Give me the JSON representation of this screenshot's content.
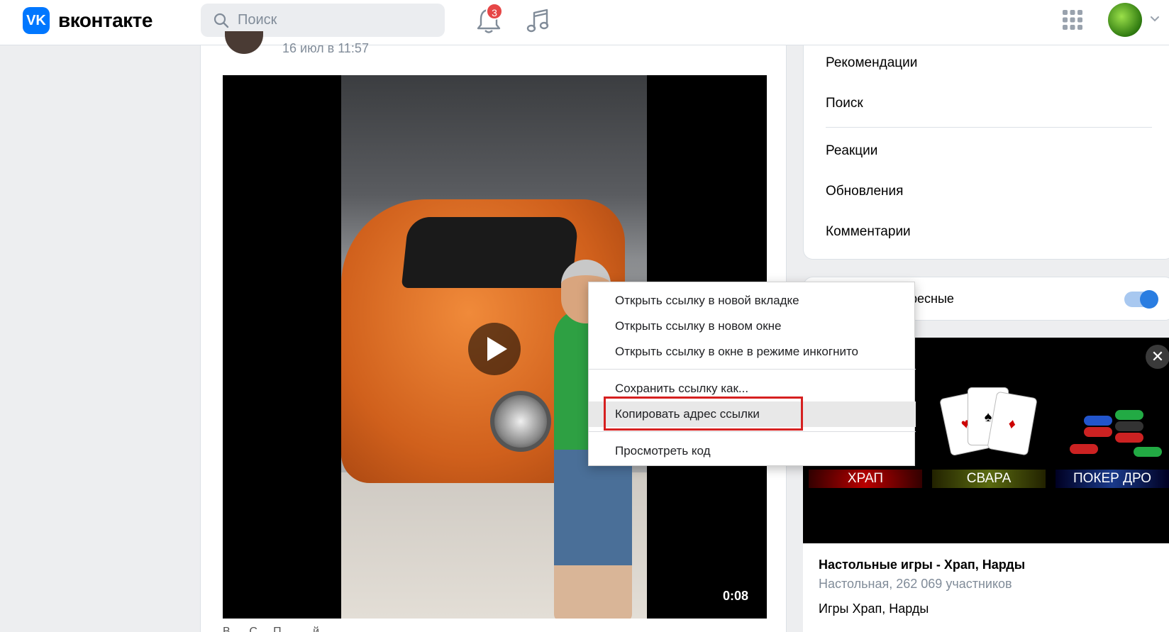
{
  "header": {
    "logo_text": "вконтакте",
    "search_placeholder": "Поиск",
    "notifications_count": "3"
  },
  "post": {
    "date": "16 июл в 11:57",
    "video_duration": "0:08",
    "text": "В......С.... П..........й"
  },
  "right_menu": {
    "items": [
      "Рекомендации",
      "Поиск",
      "Реакции",
      "Обновления",
      "Комментарии"
    ]
  },
  "toggle_card": {
    "label": "ересные",
    "enabled": true
  },
  "ad": {
    "games": [
      "ХРАП",
      "СВАРА",
      "ПОКЕР ДРО"
    ],
    "title": "Настольные игры - Храп, Нарды",
    "subtitle": "Настольная, 262 069 участников",
    "description": "Игры Храп, Нарды"
  },
  "context_menu": {
    "items": [
      "Открыть ссылку в новой вкладке",
      "Открыть ссылку в новом окне",
      "Открыть ссылку в окне в режиме инкогнито",
      "Сохранить ссылку как...",
      "Копировать адрес ссылки",
      "Просмотреть код"
    ],
    "highlighted_index": 4
  },
  "colors": {
    "brand": "#0077ff",
    "badge": "#e64646",
    "highlight_box": "#d62020"
  }
}
